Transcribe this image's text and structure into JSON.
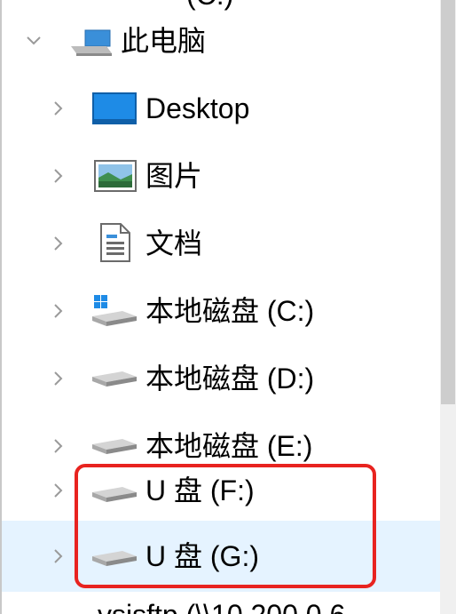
{
  "top_partial_text": "(C:)",
  "this_pc": {
    "label": "此电脑",
    "icon": "computer-icon"
  },
  "items": [
    {
      "label": "Desktop",
      "icon": "desktop-icon"
    },
    {
      "label": "图片",
      "icon": "pictures-icon"
    },
    {
      "label": "文档",
      "icon": "documents-icon"
    },
    {
      "label": "本地磁盘 (C:)",
      "icon": "windows-drive-icon"
    },
    {
      "label": "本地磁盘 (D:)",
      "icon": "drive-icon"
    },
    {
      "label": "本地磁盘 (E:)",
      "icon": "drive-icon"
    },
    {
      "label": "U 盘 (F:)",
      "icon": "usb-drive-icon"
    },
    {
      "label": "U 盘 (G:)",
      "icon": "usb-drive-icon",
      "selected": true
    }
  ],
  "bottom_partial_text": "vsjsftp (\\\\10.200.0.6",
  "colors": {
    "selection": "#e5f3ff",
    "highlight_box": "#e8231f",
    "desktop_blue": "#1e8be6"
  }
}
